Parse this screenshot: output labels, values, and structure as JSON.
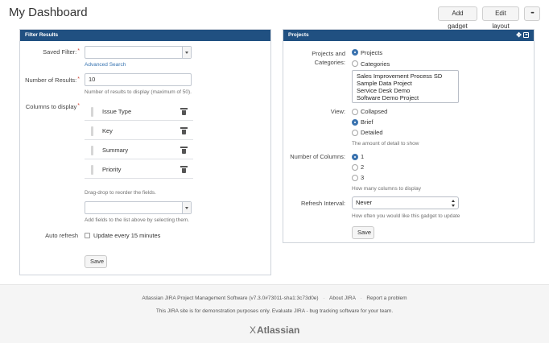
{
  "page": {
    "title": "My Dashboard",
    "buttons": {
      "add_gadget": "Add gadget",
      "edit_layout": "Edit layout",
      "more": "•••"
    }
  },
  "filter_gadget": {
    "title": "Filter Results",
    "saved_filter": {
      "label": "Saved Filter:",
      "required_mark": "*",
      "value": "",
      "advanced_search": "Advanced Search"
    },
    "num_results": {
      "label": "Number of Results:",
      "required_mark": "*",
      "value": "10",
      "help": "Number of results to display (maximum of 50)."
    },
    "columns": {
      "label": "Columns to display",
      "required_mark": "*",
      "items": [
        "Issue Type",
        "Key",
        "Summary",
        "Priority"
      ],
      "help_reorder": "Drag-drop to reorder the fields.",
      "add_value": "",
      "help_add": "Add fields to the list above by selecting them."
    },
    "auto_refresh": {
      "label": "Auto refresh",
      "option": "Update every 15 minutes",
      "checked": false
    },
    "save": "Save"
  },
  "projects_gadget": {
    "title": "Projects",
    "header_icons": [
      "move-icon",
      "dropdown-menu-icon"
    ],
    "projects_categories": {
      "label_line1": "Projects and",
      "label_line2": "Categories:",
      "options": [
        "Projects",
        "Categories"
      ],
      "selected": "Projects",
      "list": [
        "Sales Improvement Process SD",
        "Sample Data Project",
        "Service Desk Demo",
        "Software Demo Project"
      ]
    },
    "view": {
      "label": "View:",
      "options": [
        "Collapsed",
        "Brief",
        "Detailed"
      ],
      "selected": "Brief",
      "help": "The amount of detail to show"
    },
    "num_columns": {
      "label": "Number of Columns:",
      "options": [
        "1",
        "2",
        "3"
      ],
      "selected": "1",
      "help": "How many columns to display"
    },
    "refresh": {
      "label": "Refresh Interval:",
      "value": "Never",
      "help": "How often you would like this gadget to update"
    },
    "save": "Save"
  },
  "footer": {
    "line1": {
      "product": "Atlassian JIRA Project Management Software (v7.3.0#73011-sha1:3c73d0e)",
      "about": "About JIRA",
      "report": "Report a problem",
      "separator": "·"
    },
    "line2": "This JIRA site is for demonstration purposes only. Evaluate JIRA - bug tracking software for your team.",
    "logo_text": "Atlassian",
    "logo_mark": "X"
  },
  "colors": {
    "gadget_header": "#205081",
    "link": "#3572b0",
    "radio_selected": "#3b73af",
    "required": "#d04437"
  }
}
